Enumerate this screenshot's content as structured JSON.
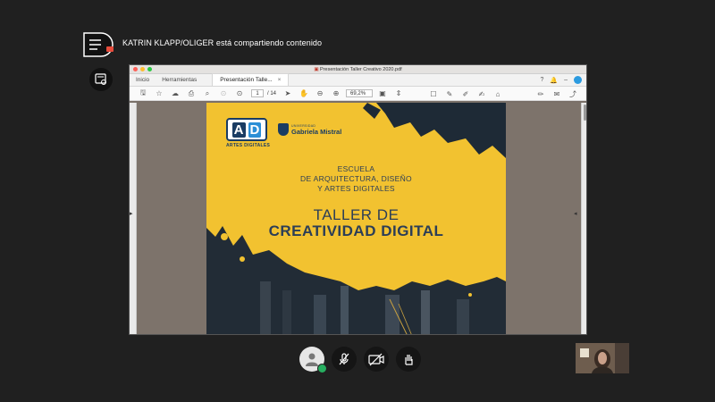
{
  "sharing": {
    "banner_text": "KATRIN KLAPP/OLIGER está compartiendo contenido"
  },
  "window": {
    "title": "Presentación Taller Creativo 2020.pdf",
    "tabs": [
      {
        "label": "Inicio"
      },
      {
        "label": "Herramientas"
      },
      {
        "label": "Presentación Talle..."
      }
    ],
    "tab_close": "×",
    "toolbar": {
      "page_current": "1",
      "page_total": "/ 14",
      "zoom": "69,2%"
    }
  },
  "slide": {
    "logo_ad_letters": [
      "A",
      "D"
    ],
    "logo_ad_sub": "ARTES DIGITALES",
    "logo_ugm_small": "UNIVERSIDAD",
    "logo_ugm_name": "Gabriela Mistral",
    "school_lines": [
      "ESCUELA",
      "DE ARQUITECTURA, DISEÑO",
      "Y ARTES DIGITALES"
    ],
    "title_line1": "TALLER DE",
    "title_line2": "CREATIVIDAD DIGITAL"
  },
  "colors": {
    "background": "#202020",
    "slide_yellow": "#f2c230",
    "navy": "#2c3e57",
    "status_green": "#27ae60"
  },
  "icons": {
    "share": "share-screen-icon",
    "side": "device-icon",
    "controls": [
      "participant-icon",
      "mic-off-icon",
      "camera-off-icon",
      "hand-icon"
    ]
  }
}
